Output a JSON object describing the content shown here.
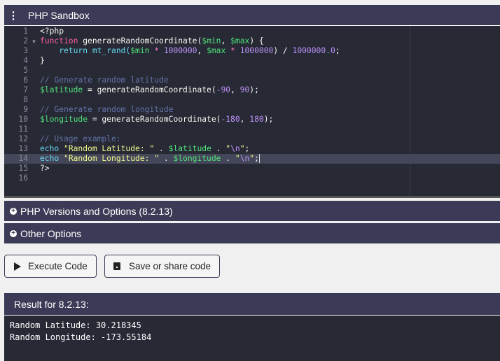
{
  "title": "PHP Sandbox",
  "code_lines": [
    "1",
    "2",
    "3",
    "4",
    "5",
    "6",
    "7",
    "8",
    "9",
    "10",
    "11",
    "12",
    "13",
    "14",
    "15",
    "16"
  ],
  "code": {
    "l1": "<?php",
    "l2a": "function",
    "l2b": " generateRandomCoordinate(",
    "l2c": "$min",
    "l2d": ", ",
    "l2e": "$max",
    "l2f": ") {",
    "l3a": "    return",
    "l3b": " mt_rand(",
    "l3c": "$min",
    "l3d": " * ",
    "l3e": "1000000",
    "l3f": ", ",
    "l3g": "$max",
    "l3h": " * ",
    "l3i": "1000000",
    "l3j": ") / ",
    "l3k": "1000000.0",
    "l3l": ";",
    "l4": "}",
    "l6": "// Generate random latitude",
    "l7a": "$latitude",
    "l7b": " = generateRandomCoordinate(",
    "l7c": "-90",
    "l7d": ", ",
    "l7e": "90",
    "l7f": ");",
    "l9": "// Generate random longitude",
    "l10a": "$longitude",
    "l10b": " = generateRandomCoordinate(",
    "l10c": "-180",
    "l10d": ", ",
    "l10e": "180",
    "l10f": ");",
    "l12": "// Usage example:",
    "l13a": "echo",
    "l13b": " \"Random Latitude: \"",
    "l13c": " . ",
    "l13d": "$latitude",
    "l13e": " . ",
    "l13f": "\"",
    "l13g": "\\n",
    "l13h": "\"",
    ";": ";",
    "l14a": "echo",
    "l14b": " \"Random Longitude: \"",
    "l14c": " . ",
    "l14d": "$longitude",
    "l14e": " . ",
    "l14f": "\"",
    "l14g": "\\n",
    "l14h": "\"",
    "l15": "?>"
  },
  "accordion": [
    {
      "label": "PHP Versions and Options (8.2.13)"
    },
    {
      "label": "Other Options"
    }
  ],
  "buttons": {
    "execute": "Execute Code",
    "save": "Save or share code"
  },
  "result": {
    "header": "Result for 8.2.13:",
    "output": "Random Latitude: 30.218345\nRandom Longitude: -173.55184"
  }
}
